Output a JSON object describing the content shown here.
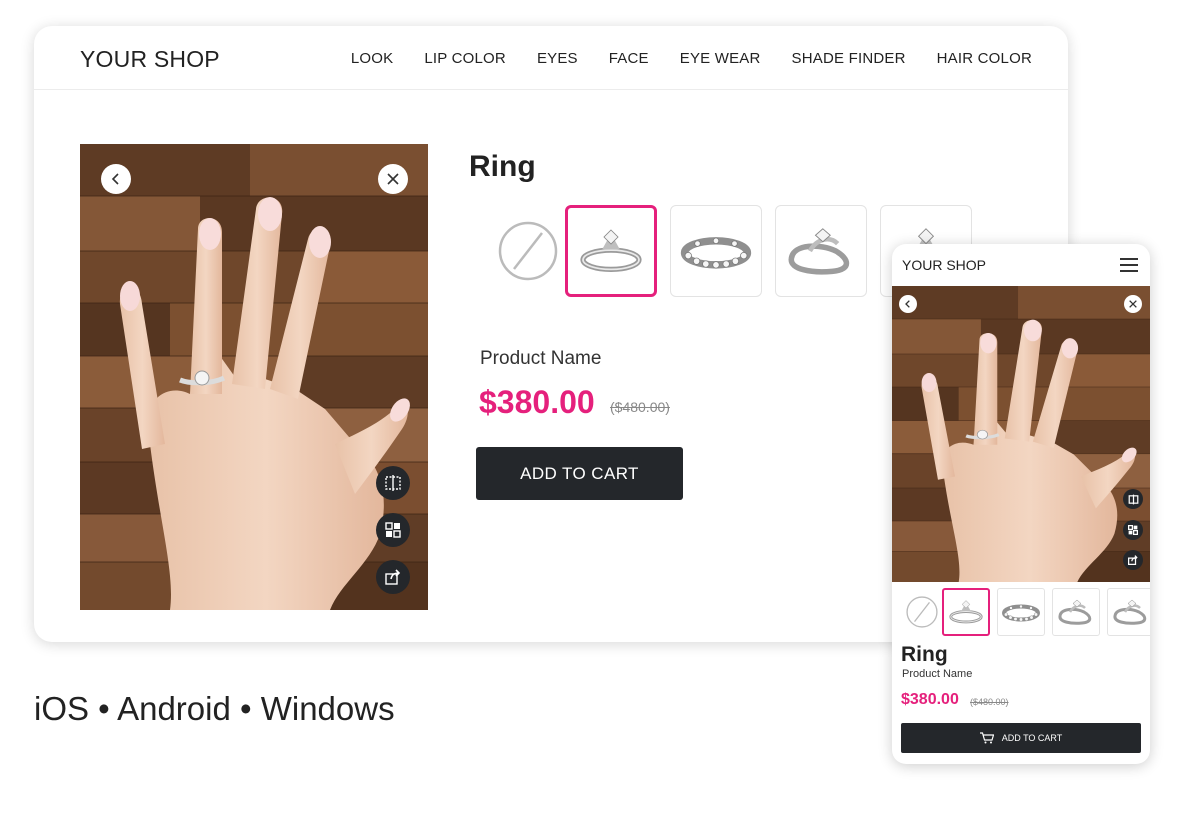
{
  "brand_color": "#e5207c",
  "desktop": {
    "logo": "YOUR SHOP",
    "nav": [
      "LOOK",
      "LIP COLOR",
      "EYES",
      "FACE",
      "EYE WEAR",
      "SHADE FINDER",
      "HAIR COLOR"
    ],
    "product": {
      "title": "Ring",
      "name": "Product Name",
      "price": "$380.00",
      "old_price": "($480.00)",
      "cart_label": "ADD TO CART"
    },
    "variants": [
      "none-icon",
      "solitaire-ring-icon",
      "eternity-band-icon",
      "twist-ring-icon",
      "ring-icon"
    ],
    "selected_variant": 1
  },
  "platforms": "iOS • Android • Windows",
  "mobile": {
    "logo": "YOUR SHOP",
    "product": {
      "title": "Ring",
      "name": "Product Name",
      "price": "$380.00",
      "old_price": "($480.00)",
      "cart_label": "ADD TO CART"
    }
  }
}
